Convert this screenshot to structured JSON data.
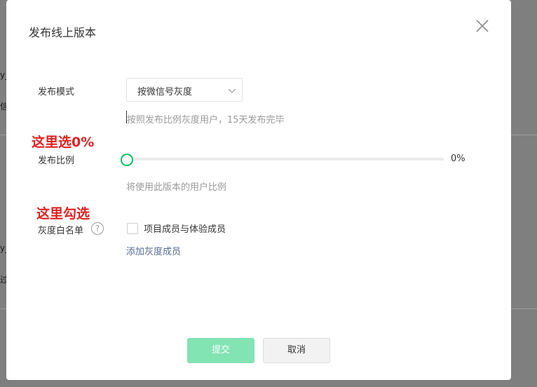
{
  "background": {
    "fragments": [
      "y_",
      "信-",
      "y_",
      "过i"
    ]
  },
  "dialog": {
    "title": "发布线上版本",
    "close_icon": "close-icon",
    "release_mode": {
      "label": "发布模式",
      "selected": "按微信号灰度",
      "hint": "按照发布比例灰度用户，15天发布完毕"
    },
    "annotation_ratio": "这里选0%",
    "release_ratio": {
      "label": "发布比例",
      "value": 0,
      "value_text": "0%",
      "hint": "将使用此版本的用户比例"
    },
    "annotation_whitelist": "这里勾选",
    "gray_whitelist": {
      "label": "灰度白名单",
      "help_icon_text": "?",
      "checkbox_label": "项目成员与体验成员",
      "checked": false,
      "add_link": "添加灰度成员"
    },
    "buttons": {
      "submit": "提交",
      "cancel": "取消"
    }
  },
  "colors": {
    "accent": "#07c160",
    "annotation": "#e02020",
    "link": "#576b95",
    "submit_disabled": "#82e3b3"
  }
}
